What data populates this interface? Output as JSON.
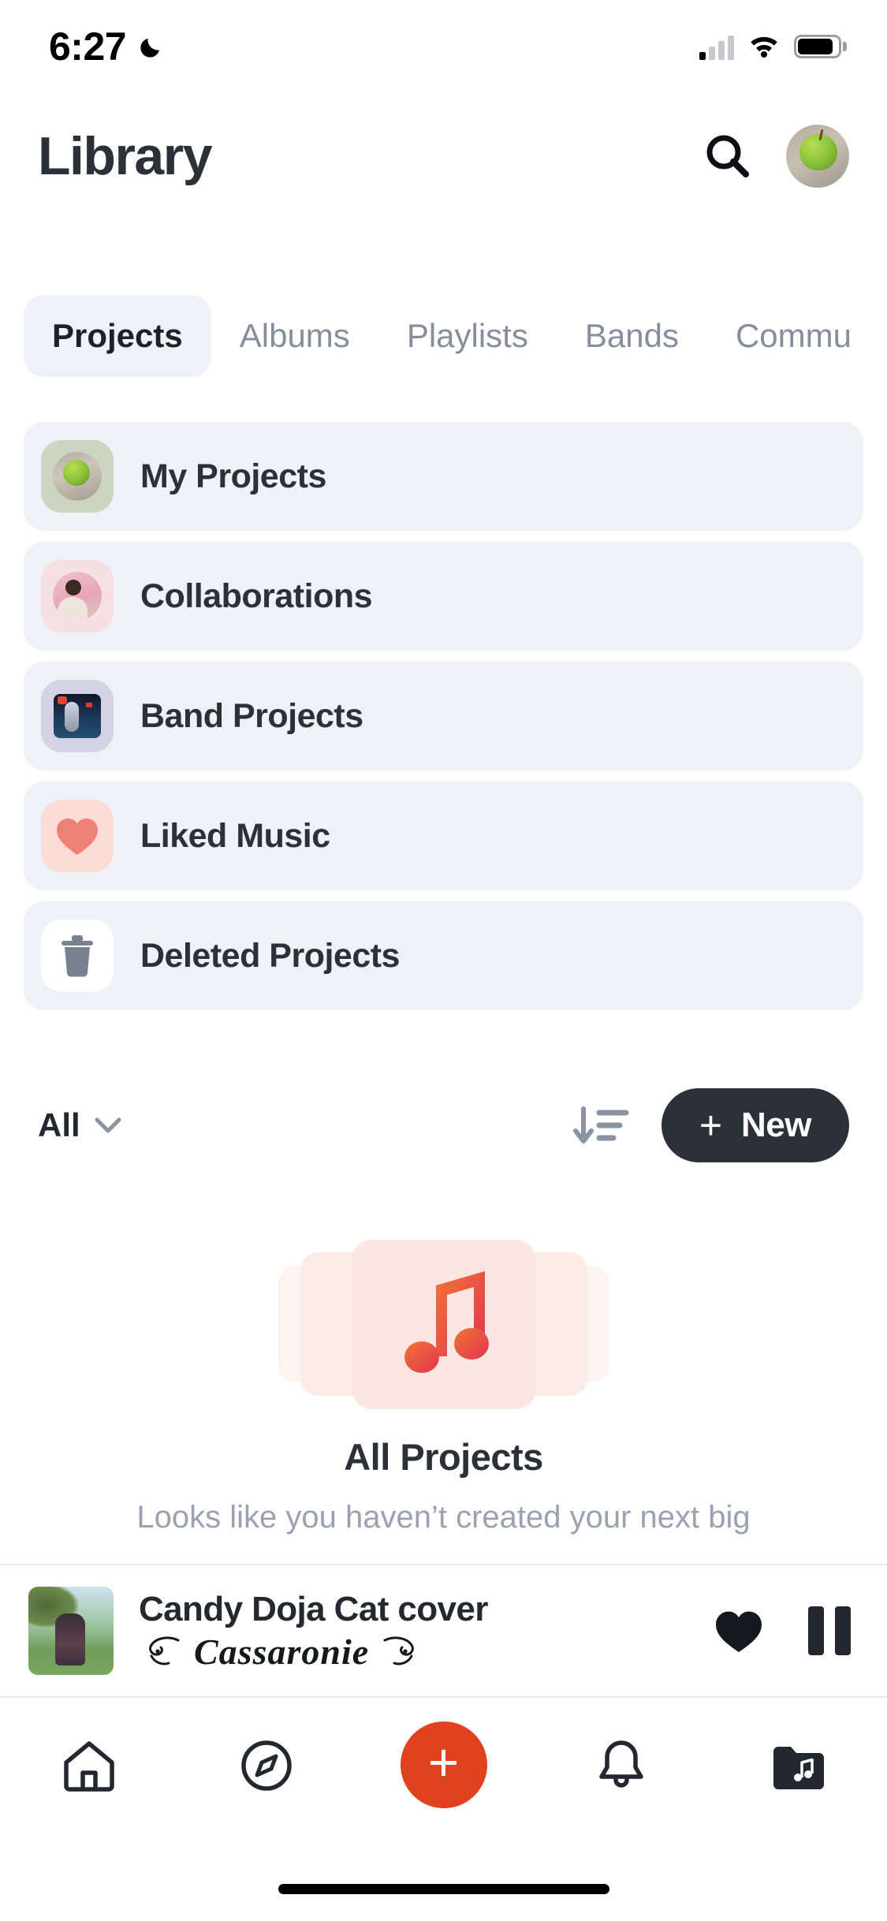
{
  "status_bar": {
    "time": "6:27",
    "dnd_icon": "moon-icon",
    "signal_icon": "cellular-signal-icon",
    "wifi_icon": "wifi-icon",
    "battery_icon": "battery-icon"
  },
  "header": {
    "title": "Library",
    "search_icon": "search-icon",
    "avatar_icon": "user-avatar"
  },
  "tabs": [
    {
      "label": "Projects",
      "active": true
    },
    {
      "label": "Albums",
      "active": false
    },
    {
      "label": "Playlists",
      "active": false
    },
    {
      "label": "Bands",
      "active": false
    },
    {
      "label": "Commu",
      "active": false
    }
  ],
  "library_rows": [
    {
      "label": "My Projects",
      "icon": "apple-photo-thumbnail",
      "bg": "#ccd4c2"
    },
    {
      "label": "Collaborations",
      "icon": "person-photo-thumbnail",
      "bg": "#f7dfe6"
    },
    {
      "label": "Band Projects",
      "icon": "band-photo-thumbnail",
      "bg": "#d5d2e4"
    },
    {
      "label": "Liked Music",
      "icon": "heart-icon",
      "bg": "#fbdcd6"
    },
    {
      "label": "Deleted Projects",
      "icon": "trash-icon",
      "bg": "#ffffff"
    }
  ],
  "filter_bar": {
    "filter_value": "All",
    "chevron_icon": "chevron-down-icon",
    "sort_icon": "sort-descending-icon",
    "new_button_plus": "+",
    "new_button_label": "New"
  },
  "empty_state": {
    "illustration_icon": "music-note-icon",
    "title": "All Projects",
    "subtitle": "Looks like you haven’t created your next big"
  },
  "player": {
    "artwork_icon": "track-artwork",
    "track_title": "Candy Doja Cat cover",
    "artist": "Cassaronie",
    "flourish_left_icon": "flourish-ornament-icon",
    "flourish_right_icon": "flourish-ornament-icon",
    "like_icon": "heart-filled-icon",
    "playback_icon": "pause-icon"
  },
  "bottom_nav": [
    {
      "icon": "home-icon",
      "label": ""
    },
    {
      "icon": "compass-icon",
      "label": ""
    },
    {
      "icon": "plus-icon",
      "label": ""
    },
    {
      "icon": "bell-icon",
      "label": ""
    },
    {
      "icon": "library-music-icon",
      "label": ""
    }
  ],
  "colors": {
    "accent": "#e0411f",
    "dark": "#2c3038",
    "row_bg": "#eef1f5",
    "muted_text": "#868e9e"
  }
}
